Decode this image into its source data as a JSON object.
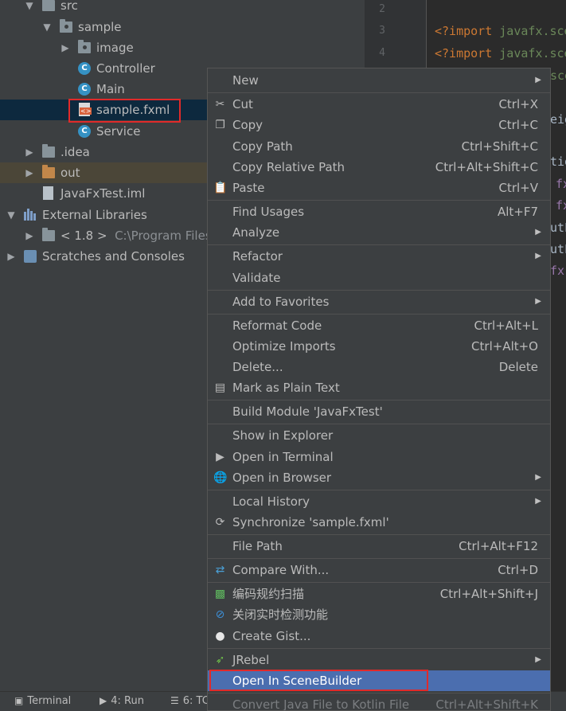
{
  "tree": {
    "items": [
      {
        "label": "src"
      },
      {
        "label": "sample"
      },
      {
        "label": "image"
      },
      {
        "label": "Controller"
      },
      {
        "label": "Main"
      },
      {
        "label": "sample.fxml"
      },
      {
        "label": "Service"
      },
      {
        "label": ".idea"
      },
      {
        "label": "out"
      },
      {
        "label": "JavaFxTest.iml"
      },
      {
        "label": "External Libraries"
      },
      {
        "label": "< 1.8 >",
        "path": "C:\\Program Files\\"
      },
      {
        "label": "Scratches and Consoles"
      }
    ]
  },
  "editor": {
    "line_numbers": [
      "2",
      "3",
      "4"
    ],
    "lines": [
      {
        "tag": "<?import",
        "pkg": "javafx.sce"
      },
      {
        "tag": "<?import",
        "pkg": "javafx.sce"
      },
      {
        "pkg": "sce"
      },
      {
        "txt": "eig"
      },
      {
        "txt": "tio"
      },
      {
        "attr": "fx"
      },
      {
        "attr": "fx"
      },
      {
        "txt": "utL"
      },
      {
        "txt": "utL"
      },
      {
        "attr": "fx"
      }
    ]
  },
  "menu": {
    "items": [
      {
        "label": "New",
        "shortcut": "",
        "submenu": true
      },
      {
        "label": "Cut",
        "shortcut": "Ctrl+X",
        "icon": "scissors-icon"
      },
      {
        "label": "Copy",
        "shortcut": "Ctrl+C",
        "icon": "copy-icon"
      },
      {
        "label": "Copy Path",
        "shortcut": "Ctrl+Shift+C"
      },
      {
        "label": "Copy Relative Path",
        "shortcut": "Ctrl+Alt+Shift+C"
      },
      {
        "label": "Paste",
        "shortcut": "Ctrl+V",
        "icon": "clipboard-icon"
      },
      {
        "label": "Find Usages",
        "shortcut": "Alt+F7"
      },
      {
        "label": "Analyze",
        "shortcut": "",
        "submenu": true
      },
      {
        "label": "Refactor",
        "shortcut": "",
        "submenu": true
      },
      {
        "label": "Validate",
        "shortcut": ""
      },
      {
        "label": "Add to Favorites",
        "shortcut": "",
        "submenu": true
      },
      {
        "label": "Reformat Code",
        "shortcut": "Ctrl+Alt+L"
      },
      {
        "label": "Optimize Imports",
        "shortcut": "Ctrl+Alt+O"
      },
      {
        "label": "Delete...",
        "shortcut": "Delete"
      },
      {
        "label": "Mark as Plain Text",
        "shortcut": "",
        "icon": "plain-text-icon"
      },
      {
        "label": "Build Module 'JavaFxTest'",
        "shortcut": ""
      },
      {
        "label": "Show in Explorer",
        "shortcut": ""
      },
      {
        "label": "Open in Terminal",
        "shortcut": "",
        "icon": "terminal-icon"
      },
      {
        "label": "Open in Browser",
        "shortcut": "",
        "submenu": true,
        "icon": "globe-icon"
      },
      {
        "label": "Local History",
        "shortcut": "",
        "submenu": true
      },
      {
        "label": "Synchronize 'sample.fxml'",
        "shortcut": "",
        "icon": "sync-icon"
      },
      {
        "label": "File Path",
        "shortcut": "Ctrl+Alt+F12"
      },
      {
        "label": "Compare With...",
        "shortcut": "Ctrl+D",
        "icon": "compare-icon"
      },
      {
        "label": "编码规约扫描",
        "shortcut": "Ctrl+Alt+Shift+J",
        "icon": "code-scan-icon"
      },
      {
        "label": "关闭实时检测功能",
        "shortcut": "",
        "icon": "disable-detection-icon"
      },
      {
        "label": "Create Gist...",
        "shortcut": "",
        "icon": "github-icon"
      },
      {
        "label": "JRebel",
        "shortcut": "",
        "submenu": true,
        "icon": "jrebel-icon"
      },
      {
        "label": "Open In SceneBuilder",
        "shortcut": "",
        "highlighted": true
      },
      {
        "label": "Convert Java File to Kotlin File",
        "shortcut": "Ctrl+Alt+Shift+K"
      }
    ]
  },
  "bottombar": {
    "terminal": "Terminal",
    "run": "4: Run",
    "todo": "6: TC"
  },
  "colors": {
    "highlight": "#4b6eaf",
    "selection_row": "#0d293e",
    "annotation_red": "#e02a2a"
  }
}
